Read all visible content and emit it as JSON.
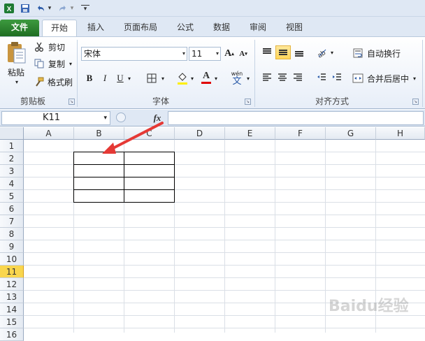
{
  "app": {
    "name": "Microsoft Excel"
  },
  "quick_access": {
    "items": [
      "excel-logo",
      "save",
      "undo",
      "redo",
      "customize"
    ],
    "undo_arrow": "▾",
    "redo_arrow": "▾",
    "customize_label": "▾"
  },
  "tabs": [
    {
      "label": "文件"
    },
    {
      "label": "开始"
    },
    {
      "label": "插入"
    },
    {
      "label": "页面布局"
    },
    {
      "label": "公式"
    },
    {
      "label": "数据"
    },
    {
      "label": "审阅"
    },
    {
      "label": "视图"
    }
  ],
  "ribbon": {
    "clipboard": {
      "paste_label": "粘贴",
      "cut_label": "剪切",
      "copy_label": "复制",
      "format_painter_label": "格式刷",
      "group_label": "剪贴板"
    },
    "font": {
      "font_name": "宋体",
      "font_size": "11",
      "grow_label": "A",
      "shrink_label": "A",
      "bold_label": "B",
      "italic_label": "I",
      "underline_label": "U",
      "font_color_label": "A",
      "phonetic_label": "wén",
      "phonetic_char": "文",
      "group_label": "字体"
    },
    "alignment": {
      "wrap_text_label": "自动换行",
      "merge_center_label": "合并后居中",
      "group_label": "对齐方式"
    }
  },
  "formula_bar": {
    "name_box": "K11",
    "fx_label": "fx",
    "formula": ""
  },
  "sheet": {
    "columns": [
      "A",
      "B",
      "C",
      "D",
      "E",
      "F",
      "G",
      "H"
    ],
    "rows": [
      "1",
      "2",
      "3",
      "4",
      "5",
      "6",
      "7",
      "8",
      "9",
      "10",
      "11",
      "12",
      "13",
      "14",
      "15",
      "16"
    ],
    "active_row": "11"
  },
  "colors": {
    "file_tab": "#2e7d32",
    "highlight_row": "#f9d64d",
    "arrow": "#e53935"
  },
  "watermark": "Baidu经验"
}
